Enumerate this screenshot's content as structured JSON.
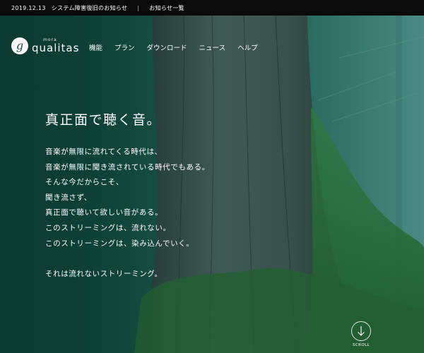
{
  "topbar": {
    "date": "2019.12.13",
    "notice": "システム障害復旧のお知らせ",
    "separator": "|",
    "all_news": "お知らせ一覧"
  },
  "logo": {
    "mark": "g",
    "small": "mora",
    "main": "qualitas"
  },
  "nav": {
    "items": [
      "機能",
      "プラン",
      "ダウンロード",
      "ニュース",
      "ヘルプ"
    ]
  },
  "hero": {
    "headline": "真正面で聴く音。",
    "lines": [
      "音楽が無限に流れてくる時代は、",
      "音楽が無限に聞き流されている時代でもある。",
      "そんな今だからこそ、",
      "聞き流さず、",
      "真正面で聴いて欲しい音がある。",
      "このストリーミングは、流れない。",
      "このストリーミングは、染み込んでいく。"
    ],
    "closing": "それは流れないストリーミング。"
  },
  "scroll": {
    "label": "SCROLL",
    "icon": "arrow-down-icon"
  },
  "colors": {
    "topbar_bg": "#0a0a0a",
    "forest_dark": "#0d3d33",
    "forest_light": "#4a8a82",
    "moss": "#2f7a3d"
  }
}
